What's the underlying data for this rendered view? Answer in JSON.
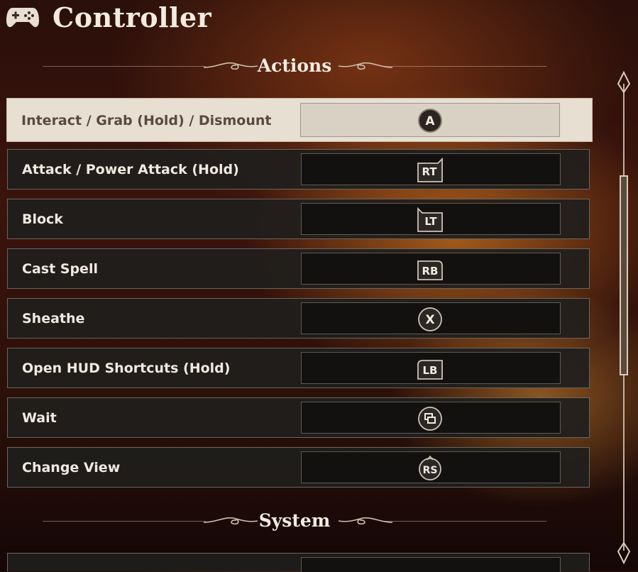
{
  "header": {
    "title": "Controller",
    "icon": "gamepad-icon"
  },
  "sections": [
    {
      "label": "Actions"
    },
    {
      "label": "System"
    }
  ],
  "bindings": [
    {
      "action": "Interact / Grab (Hold) / Dismount",
      "button": "A",
      "icon": "button-a-icon",
      "selected": true
    },
    {
      "action": "Attack / Power Attack (Hold)",
      "button": "RT",
      "icon": "right-trigger-icon"
    },
    {
      "action": "Block",
      "button": "LT",
      "icon": "left-trigger-icon"
    },
    {
      "action": "Cast Spell",
      "button": "RB",
      "icon": "right-bumper-icon"
    },
    {
      "action": "Sheathe",
      "button": "X",
      "icon": "button-x-icon"
    },
    {
      "action": "Open HUD Shortcuts (Hold)",
      "button": "LB",
      "icon": "left-bumper-icon"
    },
    {
      "action": "Wait",
      "button": "",
      "icon": "view-button-icon"
    },
    {
      "action": "Change View",
      "button": "RS",
      "icon": "right-stick-click-icon"
    }
  ],
  "colors": {
    "accent_text": "#f2ebe0",
    "selected_row": "#e7dfd2",
    "row_bg": "#201e1c"
  }
}
